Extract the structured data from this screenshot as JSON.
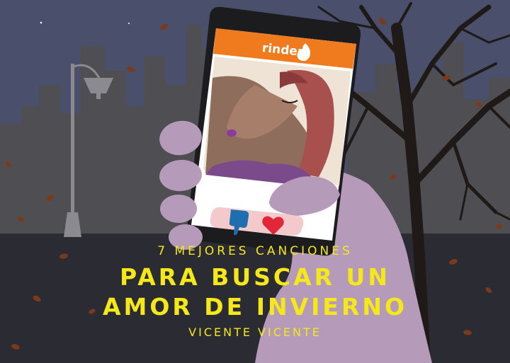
{
  "app": {
    "logo_text": "rinder",
    "logo_icon": "flame-icon"
  },
  "buttons": {
    "dislike_icon": "thumbs-down-icon",
    "like_icon": "heart-icon"
  },
  "headline": {
    "kicker": "7 MEJORES CANCIONES",
    "line1": "PARA BUSCAR UN",
    "line2": "AMOR DE INVIERNO",
    "author": "VICENTE VICENTE"
  },
  "colors": {
    "sky": "#4a4f6b",
    "skyline": "#4f4f53",
    "ground": "#2b2b33",
    "accent_orange": "#f07a1e",
    "title_yellow": "#f5e81a",
    "hand": "#b59ab9",
    "phone": "#1c1c1f",
    "dislike_blue": "#1f6fb0",
    "like_red": "#e3273a"
  }
}
